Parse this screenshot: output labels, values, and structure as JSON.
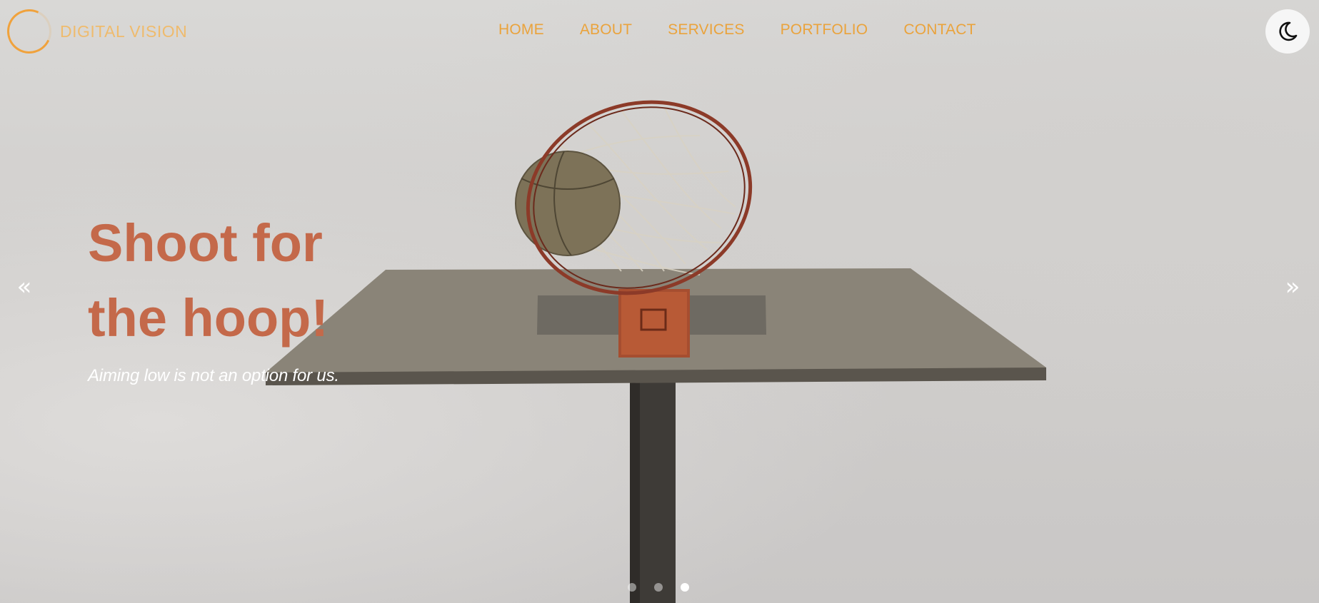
{
  "brand": {
    "logo_text": "DIGITAL VISION",
    "accent_color": "#f0a23c"
  },
  "nav": {
    "items": [
      {
        "label": "HOME"
      },
      {
        "label": "ABOUT"
      },
      {
        "label": "SERVICES"
      },
      {
        "label": "PORTFOLIO"
      },
      {
        "label": "CONTACT"
      }
    ],
    "link_color": "#eaa33c"
  },
  "theme_toggle": {
    "icon": "moon-icon"
  },
  "hero": {
    "title_line_1": "Shoot for",
    "title_line_2": "the hoop!",
    "subtitle": "Aiming low is not an option for us.",
    "title_color": "#c4694a",
    "image": "basketball-hoop-photo"
  },
  "carousel": {
    "prev_icon": "double-chevron-left-icon",
    "next_icon": "double-chevron-right-icon",
    "prev_glyph": "«",
    "next_glyph": "»",
    "slide_count": 3,
    "active_slide": 3
  }
}
